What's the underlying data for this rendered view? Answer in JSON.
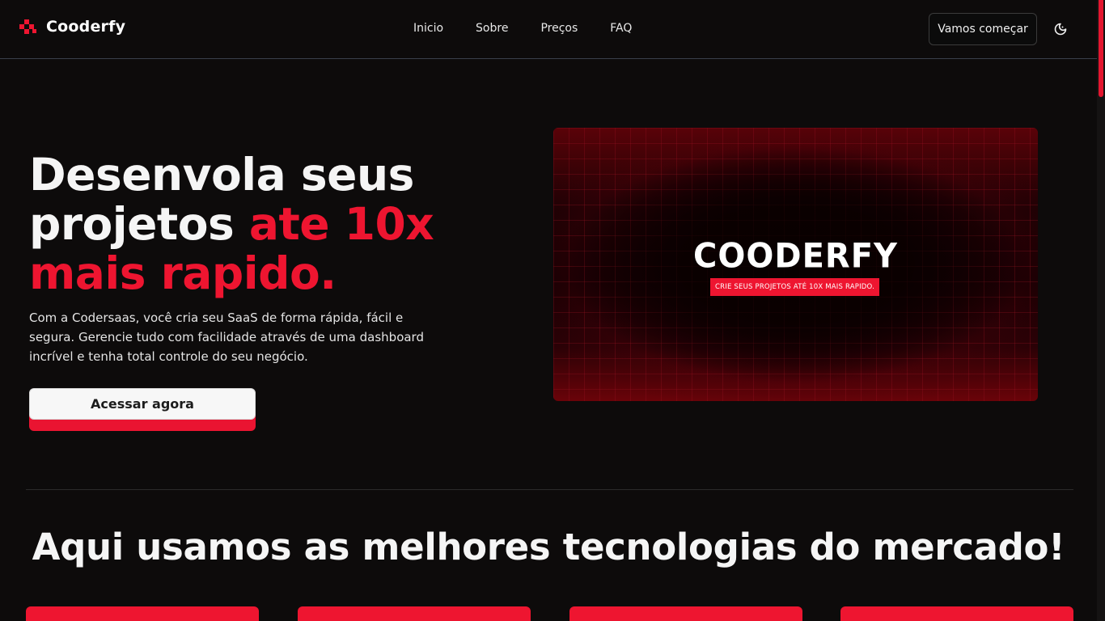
{
  "header": {
    "brand_name": "Cooderfy",
    "nav": [
      "Inicio",
      "Sobre",
      "Preços",
      "FAQ"
    ],
    "cta_label": "Vamos começar"
  },
  "hero": {
    "title_line1": "Desenvola seus",
    "title_line2_plain": "projetos ",
    "title_line2_accent": "ate 10x",
    "title_line3_accent": "mais rapido.",
    "description": "Com a Codersaas, você cria seu SaaS de forma rápida, fácil e segura. Gerencie tudo com facilidade através de uma dashboard incrível e tenha total controle do seu negócio.",
    "button_label": "Acessar agora"
  },
  "banner": {
    "logo_text": "COODERFY",
    "tagline": "CRIE SEUS PROJETOS ATÉ 10X MAIS RAPIDO."
  },
  "tech": {
    "title": "Aqui usamos as melhores tecnologias do mercado!"
  },
  "colors": {
    "accent": "#ee1530",
    "background": "#0d0b0b"
  },
  "icons": {
    "brand": "cooderfy-logo-icon",
    "theme": "theme-toggle-icon"
  }
}
